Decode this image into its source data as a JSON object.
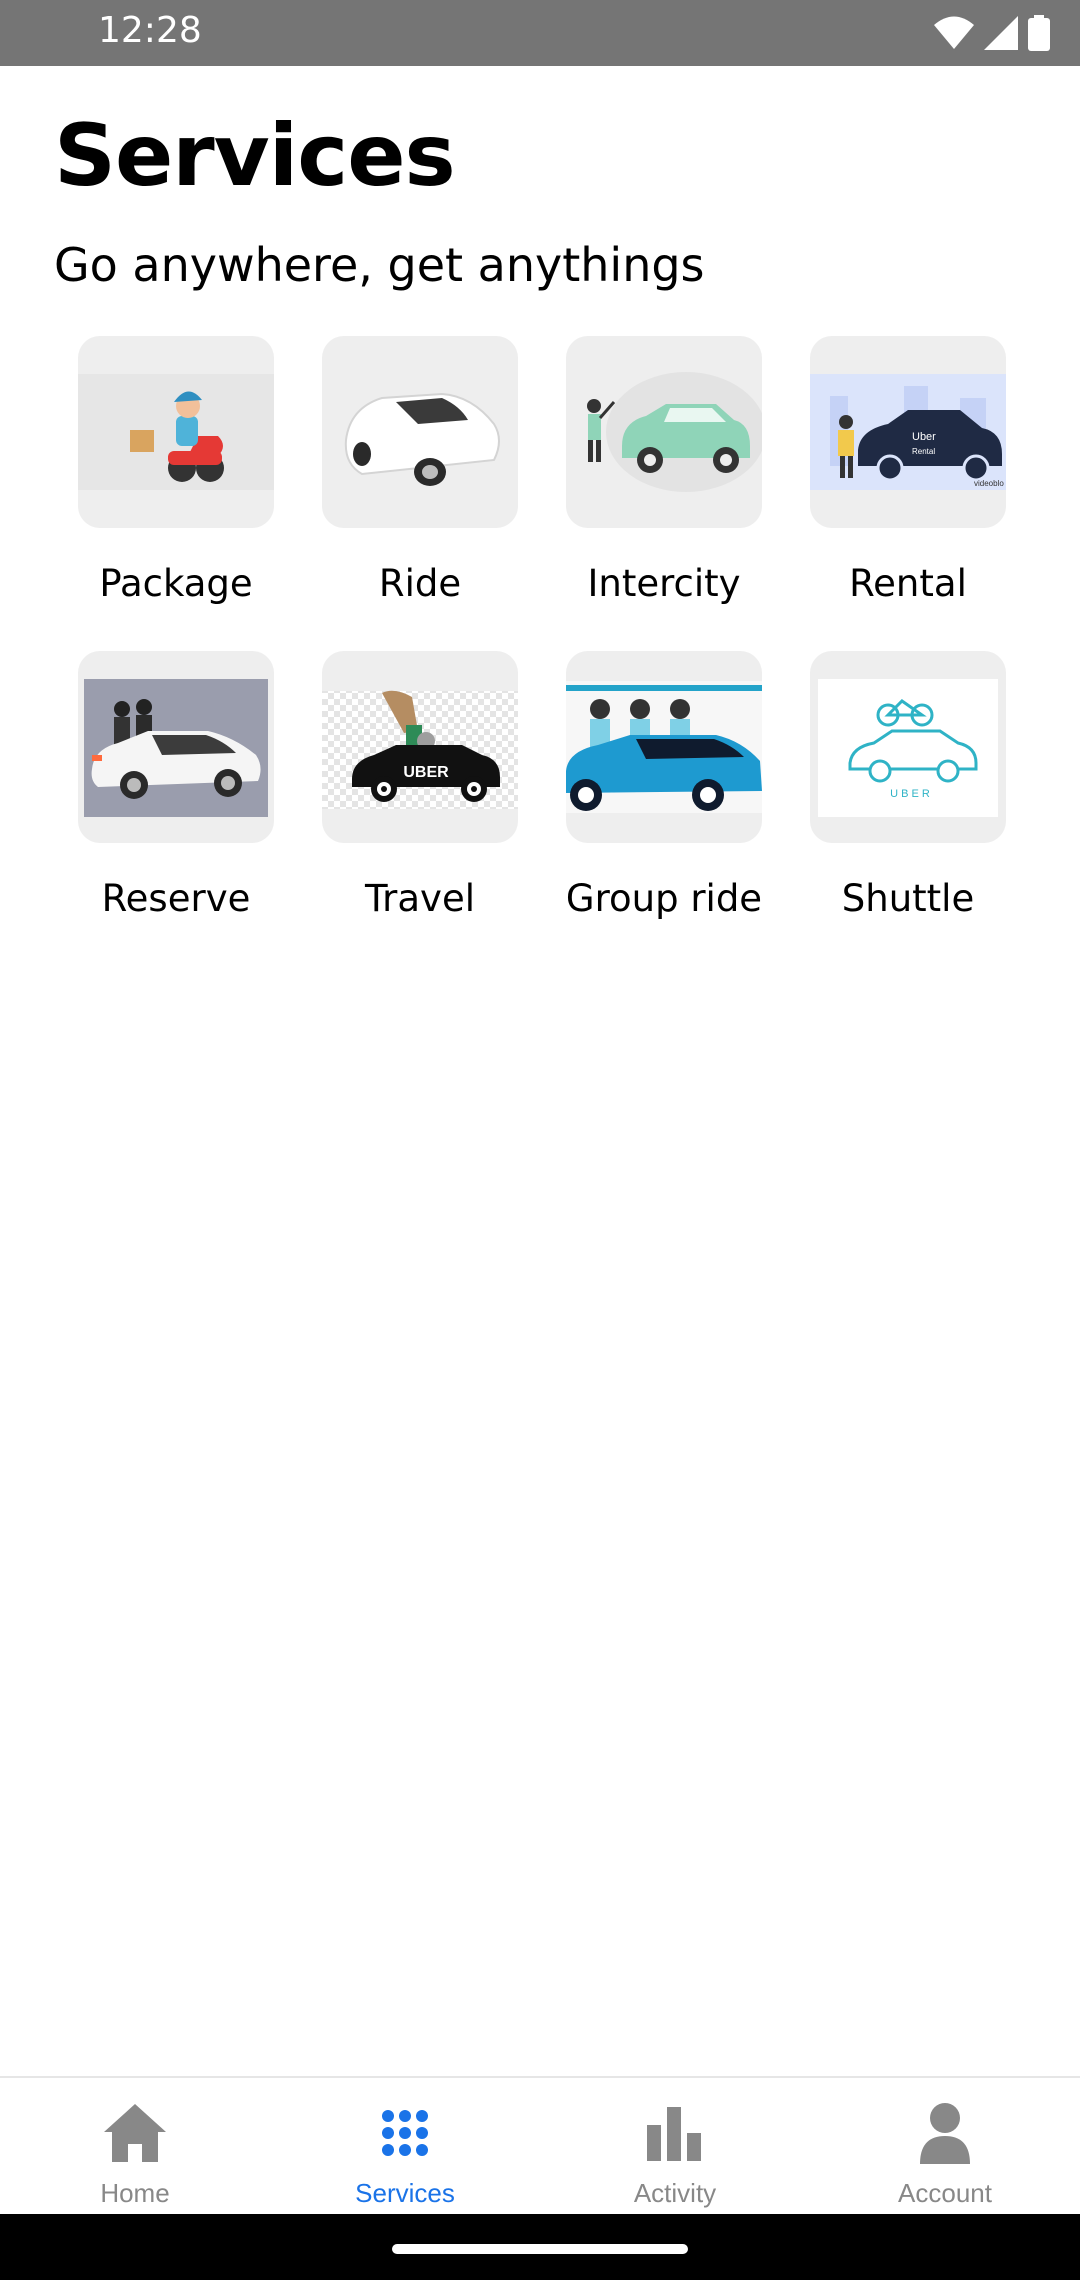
{
  "status_bar": {
    "time": "12:28"
  },
  "header": {
    "title": "Services",
    "subtitle": "Go anywhere, get anythings"
  },
  "services": [
    {
      "label": "Package",
      "icon": "package-scooter"
    },
    {
      "label": "Ride",
      "icon": "white-car"
    },
    {
      "label": "Intercity",
      "icon": "intercity-car"
    },
    {
      "label": "Rental",
      "icon": "rental-car"
    },
    {
      "label": "Reserve",
      "icon": "reserve-car"
    },
    {
      "label": "Travel",
      "icon": "uber-car"
    },
    {
      "label": "Group ride",
      "icon": "group-ride-car"
    },
    {
      "label": "Shuttle",
      "icon": "shuttle-car"
    }
  ],
  "thumb_text": {
    "rental_brand": "Uber",
    "rental_tag": "Rental",
    "rental_watermark": "videoblo",
    "travel_brand": "UBER",
    "shuttle_brand": "U B E R"
  },
  "bottom_nav": {
    "items": [
      {
        "label": "Home",
        "icon": "home-icon"
      },
      {
        "label": "Services",
        "icon": "grid-icon",
        "active": true
      },
      {
        "label": "Activity",
        "icon": "bar-chart-icon"
      },
      {
        "label": "Account",
        "icon": "person-icon"
      }
    ]
  },
  "colors": {
    "status_bar": "#757575",
    "active_nav": "#1a73e8",
    "inactive_nav": "#888888",
    "card_bg": "#eeeeee"
  }
}
